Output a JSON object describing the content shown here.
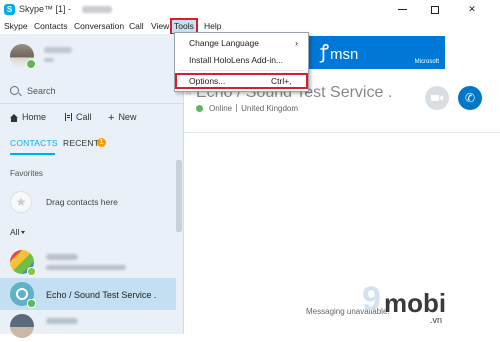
{
  "window": {
    "app_icon_glyph": "S",
    "title": "Skype™ [1] -",
    "minimize_icon": "minimize-icon",
    "maximize_icon": "maximize-icon",
    "close_glyph": "✕"
  },
  "menubar": {
    "items": [
      "Skype",
      "Contacts",
      "Conversation",
      "Call",
      "View",
      "Tools",
      "Help"
    ]
  },
  "tools_menu": {
    "items": [
      {
        "label": "Change Language",
        "shortcut": "",
        "arrow": "›"
      },
      {
        "label": "Install HoloLens Add-in...",
        "shortcut": "",
        "arrow": ""
      },
      {
        "label": "Options...",
        "shortcut": "Ctrl+,",
        "arrow": ""
      }
    ]
  },
  "sidebar": {
    "search_label": "Search",
    "nav": {
      "home": "Home",
      "call": "Call",
      "new_plus": "+",
      "new": "New"
    },
    "tabs": {
      "contacts": "CONTACTS",
      "recent": "RECENT",
      "recent_badge": "1"
    },
    "favorites_label": "Favorites",
    "drag_placeholder": "Drag contacts here",
    "filter_label": "All",
    "star_glyph": "★",
    "contacts": [
      {
        "name": "",
        "avatar": "bluestacks",
        "status_color": "#8bc34a"
      },
      {
        "name": "Echo / Sound Test Service .",
        "avatar": "echo",
        "status_color": "#5cb85c",
        "selected": true
      },
      {
        "name": "",
        "avatar": "person",
        "status_color": "#5cb85c"
      }
    ]
  },
  "chat": {
    "star_glyph": "☆",
    "title": "Echo / Sound Test Service .",
    "status": "Online",
    "location": "United Kingdom",
    "messaging_status": "Messaging unavailable.",
    "call_glyph": "✆"
  },
  "ad": {
    "logo_glyph": "ꝭ",
    "brand": "msn",
    "company": "Microsoft"
  },
  "watermark": {
    "nine": "9",
    "mobi": "mobi",
    "vn": ".vn"
  },
  "colors": {
    "skype_blue": "#00aff0",
    "msn_blue": "#0078d7",
    "highlight_red": "#d4202b",
    "online_green": "#5cb85c",
    "badge_orange": "#f69c00"
  }
}
